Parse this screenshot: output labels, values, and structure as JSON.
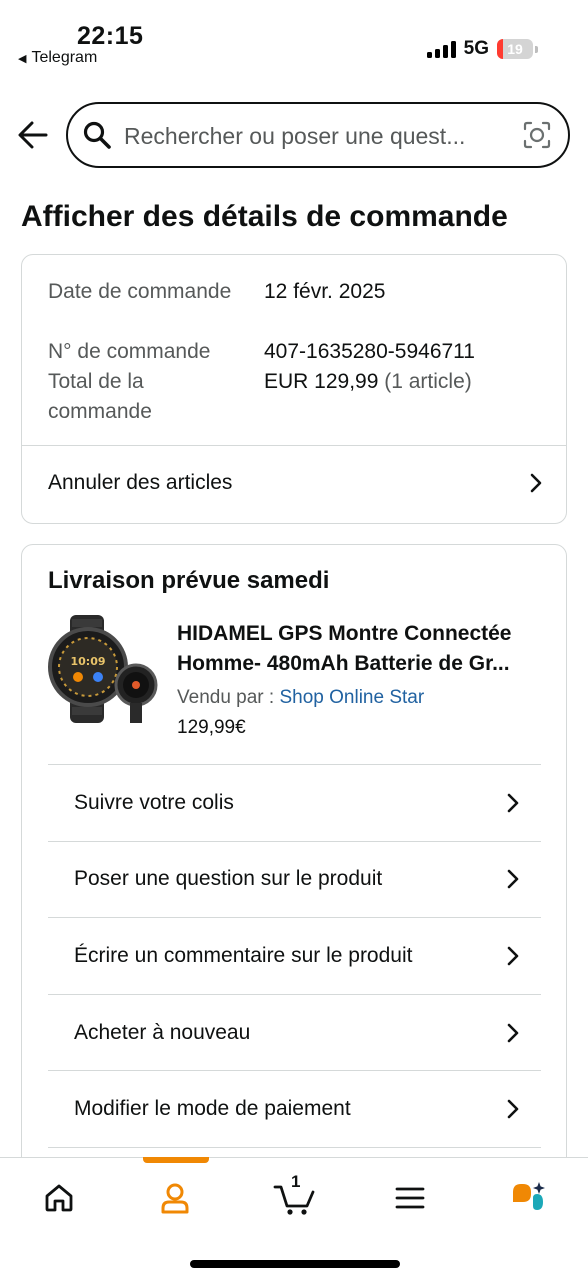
{
  "status_bar": {
    "time": "22:15",
    "back_app": "Telegram",
    "network": "5G",
    "battery": "19"
  },
  "search": {
    "placeholder": "Rechercher ou poser une quest..."
  },
  "page_title": "Afficher des détails de commande",
  "order_info": {
    "date_label": "Date de commande",
    "date_value": "12 févr. 2025",
    "number_label": "N° de commande",
    "number_value": "407-1635280-5946711",
    "total_label": "Total de la commande",
    "total_value": "EUR 129,99",
    "total_items": "(1 article)"
  },
  "cancel_link": "Annuler des articles",
  "delivery": {
    "title": "Livraison prévue samedi",
    "product_title_line1": "HIDAMEL GPS Montre Connectée",
    "product_title_line2": "Homme- 480mAh Batterie de Gr...",
    "sold_by_label": "Vendu par",
    "sold_by_sep": " : ",
    "seller": "Shop Online Star",
    "price": "129,99€",
    "watch_face_time": "10:09"
  },
  "actions": [
    {
      "label": "Suivre votre colis"
    },
    {
      "label": "Poser une question sur le produit"
    },
    {
      "label": "Écrire un commentaire sur le produit"
    },
    {
      "label": "Acheter à nouveau"
    },
    {
      "label": "Modifier le mode de paiement"
    }
  ],
  "bottom_nav": {
    "cart_count": "1",
    "items": [
      "home-icon",
      "account-icon",
      "cart-icon",
      "menu-icon",
      "rufus-assistant-icon"
    ]
  },
  "colors": {
    "accent_orange": "#f08804",
    "link_blue": "#2162a1",
    "text": "#0f1111",
    "muted": "#565959",
    "border": "#d5d9d9"
  }
}
